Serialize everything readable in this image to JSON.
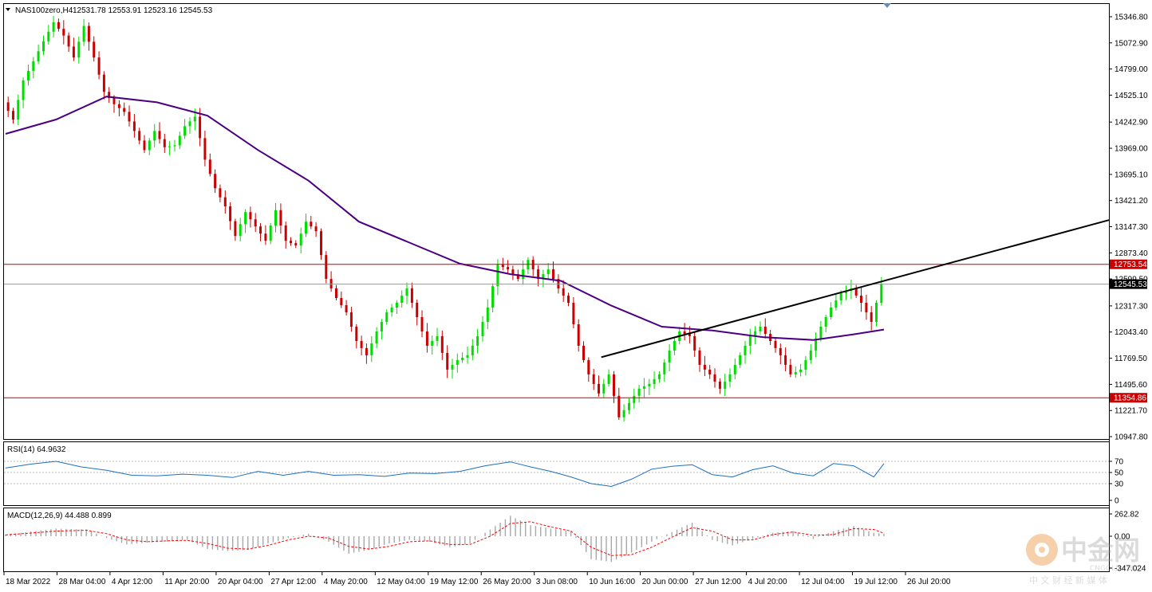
{
  "header": {
    "symbol": "NAS100zero,H4",
    "ohlc": "12531.78 12553.91 12523.16 12545.53"
  },
  "rsi_label": "RSI(14) 64.9632",
  "macd_label": "MACD(12,26,9) 44.488 0.899",
  "watermark": {
    "brand": "中金网",
    "domain": "CNGOLD.ORG",
    "slogan": "中 文 财 经 新 媒 体"
  },
  "colors": {
    "bull": "#00dd00",
    "bear": "#cc0000",
    "ma": "#4b0082",
    "hline": "#cc0000",
    "trend": "#000000",
    "rsi": "#1e6fbf",
    "macd_signal": "#ff0000",
    "macd_hist": "#a8a8a8"
  },
  "chart_data": {
    "type": "candlestick",
    "symbol": "NAS100zero",
    "timeframe": "H4",
    "last": {
      "open": 12531.78,
      "high": 12553.91,
      "low": 12523.16,
      "close": 12545.53
    },
    "price_axis_ticks": [
      "15346.80",
      "15072.90",
      "14799.00",
      "14525.10",
      "14242.90",
      "13969.00",
      "13695.10",
      "13421.20",
      "13147.30",
      "12873.40",
      "12599.50",
      "12317.30",
      "12043.40",
      "11769.50",
      "11495.60",
      "11221.70",
      "10947.80"
    ],
    "time_axis_labels": [
      "18 Mar 2022",
      "28 Mar 04:00",
      "4 Apr 12:00",
      "11 Apr 20:00",
      "20 Apr 04:00",
      "27 Apr 12:00",
      "4 May 20:00",
      "12 May 04:00",
      "19 May 12:00",
      "26 May 20:00",
      "3 Jun 08:00",
      "10 Jun 16:00",
      "20 Jun 00:00",
      "27 Jun 12:00",
      "4 Jul 20:00",
      "12 Jul 04:00",
      "19 Jul 12:00",
      "26 Jul 20:00"
    ],
    "price_path": [
      [
        0,
        14450
      ],
      [
        2,
        14270
      ],
      [
        4,
        14680
      ],
      [
        6,
        14880
      ],
      [
        8,
        15090
      ],
      [
        10,
        15290
      ],
      [
        12,
        15150
      ],
      [
        14,
        14920
      ],
      [
        16,
        15250
      ],
      [
        18,
        14920
      ],
      [
        20,
        14560
      ],
      [
        22,
        14430
      ],
      [
        24,
        14350
      ],
      [
        26,
        14150
      ],
      [
        28,
        13950
      ],
      [
        30,
        14150
      ],
      [
        32,
        13980
      ],
      [
        34,
        14000
      ],
      [
        36,
        14200
      ],
      [
        38,
        14300
      ],
      [
        40,
        13850
      ],
      [
        42,
        13550
      ],
      [
        44,
        13360
      ],
      [
        46,
        13050
      ],
      [
        48,
        13300
      ],
      [
        50,
        13150
      ],
      [
        52,
        13000
      ],
      [
        54,
        13320
      ],
      [
        56,
        13000
      ],
      [
        58,
        12950
      ],
      [
        60,
        13200
      ],
      [
        62,
        13100
      ],
      [
        64,
        12600
      ],
      [
        66,
        12400
      ],
      [
        68,
        12250
      ],
      [
        70,
        11950
      ],
      [
        72,
        11800
      ],
      [
        74,
        12050
      ],
      [
        76,
        12250
      ],
      [
        78,
        12350
      ],
      [
        80,
        12500
      ],
      [
        82,
        12200
      ],
      [
        84,
        11900
      ],
      [
        86,
        12000
      ],
      [
        88,
        11650
      ],
      [
        90,
        11750
      ],
      [
        92,
        11800
      ],
      [
        94,
        12000
      ],
      [
        96,
        12300
      ],
      [
        98,
        12750
      ],
      [
        100,
        12700
      ],
      [
        102,
        12600
      ],
      [
        104,
        12800
      ],
      [
        106,
        12600
      ],
      [
        108,
        12700
      ],
      [
        110,
        12500
      ],
      [
        112,
        12350
      ],
      [
        114,
        11900
      ],
      [
        116,
        11600
      ],
      [
        118,
        11400
      ],
      [
        120,
        11600
      ],
      [
        122,
        11150
      ],
      [
        124,
        11300
      ],
      [
        126,
        11450
      ],
      [
        128,
        11500
      ],
      [
        130,
        11600
      ],
      [
        132,
        11850
      ],
      [
        134,
        12050
      ],
      [
        136,
        12000
      ],
      [
        138,
        11700
      ],
      [
        140,
        11600
      ],
      [
        142,
        11450
      ],
      [
        144,
        11600
      ],
      [
        146,
        11800
      ],
      [
        148,
        12000
      ],
      [
        150,
        12100
      ],
      [
        152,
        11950
      ],
      [
        154,
        11800
      ],
      [
        156,
        11600
      ],
      [
        158,
        11650
      ],
      [
        160,
        11850
      ],
      [
        162,
        12100
      ],
      [
        164,
        12300
      ],
      [
        166,
        12450
      ],
      [
        168,
        12500
      ],
      [
        170,
        12350
      ],
      [
        172,
        12150
      ],
      [
        174,
        12550
      ]
    ],
    "ma_path": [
      [
        0,
        14120
      ],
      [
        10,
        14270
      ],
      [
        20,
        14510
      ],
      [
        30,
        14450
      ],
      [
        40,
        14310
      ],
      [
        50,
        13950
      ],
      [
        60,
        13630
      ],
      [
        70,
        13200
      ],
      [
        80,
        12980
      ],
      [
        90,
        12760
      ],
      [
        100,
        12650
      ],
      [
        110,
        12580
      ],
      [
        120,
        12320
      ],
      [
        130,
        12100
      ],
      [
        140,
        12060
      ],
      [
        150,
        11990
      ],
      [
        160,
        11960
      ],
      [
        168,
        12020
      ],
      [
        174,
        12070
      ]
    ],
    "horizontal_levels": [
      12753.54,
      11354.86
    ],
    "current_price_label": "12545.53",
    "trendline": {
      "from_index": 118,
      "from_price": 11780,
      "to_index": 174,
      "to_price": 12580
    },
    "rsi": {
      "ticks": [
        "70",
        "50",
        "30",
        "0"
      ],
      "levels": [
        70,
        50,
        30
      ],
      "path": [
        [
          0,
          58
        ],
        [
          5,
          65
        ],
        [
          10,
          70
        ],
        [
          15,
          60
        ],
        [
          20,
          54
        ],
        [
          25,
          45
        ],
        [
          30,
          44
        ],
        [
          35,
          47
        ],
        [
          40,
          45
        ],
        [
          45,
          41
        ],
        [
          50,
          52
        ],
        [
          55,
          45
        ],
        [
          60,
          52
        ],
        [
          65,
          45
        ],
        [
          70,
          46
        ],
        [
          75,
          43
        ],
        [
          80,
          49
        ],
        [
          85,
          48
        ],
        [
          90,
          52
        ],
        [
          95,
          62
        ],
        [
          100,
          69
        ],
        [
          104,
          60
        ],
        [
          108,
          52
        ],
        [
          112,
          42
        ],
        [
          116,
          30
        ],
        [
          120,
          25
        ],
        [
          124,
          38
        ],
        [
          128,
          56
        ],
        [
          132,
          61
        ],
        [
          136,
          64
        ],
        [
          138,
          55
        ],
        [
          140,
          46
        ],
        [
          144,
          42
        ],
        [
          148,
          55
        ],
        [
          152,
          62
        ],
        [
          156,
          49
        ],
        [
          160,
          44
        ],
        [
          164,
          66
        ],
        [
          168,
          62
        ],
        [
          172,
          42
        ],
        [
          174,
          66
        ]
      ]
    },
    "macd": {
      "ticks": [
        "262.82",
        "0.00",
        "-347.024"
      ],
      "hist_path": [
        [
          0,
          20
        ],
        [
          10,
          90
        ],
        [
          16,
          80
        ],
        [
          20,
          -20
        ],
        [
          24,
          -90
        ],
        [
          28,
          -70
        ],
        [
          32,
          -60
        ],
        [
          36,
          -40
        ],
        [
          40,
          -140
        ],
        [
          44,
          -160
        ],
        [
          48,
          -150
        ],
        [
          52,
          -80
        ],
        [
          56,
          -20
        ],
        [
          60,
          30
        ],
        [
          64,
          -60
        ],
        [
          68,
          -190
        ],
        [
          72,
          -150
        ],
        [
          76,
          -80
        ],
        [
          80,
          -40
        ],
        [
          84,
          -60
        ],
        [
          88,
          -120
        ],
        [
          92,
          -80
        ],
        [
          96,
          80
        ],
        [
          100,
          240
        ],
        [
          104,
          130
        ],
        [
          108,
          90
        ],
        [
          112,
          60
        ],
        [
          116,
          -250
        ],
        [
          120,
          -280
        ],
        [
          124,
          -180
        ],
        [
          128,
          -60
        ],
        [
          132,
          50
        ],
        [
          136,
          160
        ],
        [
          140,
          -40
        ],
        [
          144,
          -100
        ],
        [
          148,
          -30
        ],
        [
          152,
          40
        ],
        [
          156,
          60
        ],
        [
          160,
          -30
        ],
        [
          164,
          60
        ],
        [
          168,
          120
        ],
        [
          172,
          40
        ],
        [
          174,
          30
        ]
      ],
      "signal_path": [
        [
          0,
          15
        ],
        [
          10,
          60
        ],
        [
          16,
          70
        ],
        [
          20,
          30
        ],
        [
          24,
          -40
        ],
        [
          28,
          -60
        ],
        [
          32,
          -50
        ],
        [
          36,
          -45
        ],
        [
          40,
          -80
        ],
        [
          44,
          -130
        ],
        [
          48,
          -140
        ],
        [
          52,
          -100
        ],
        [
          56,
          -40
        ],
        [
          60,
          0
        ],
        [
          64,
          -20
        ],
        [
          68,
          -110
        ],
        [
          72,
          -140
        ],
        [
          76,
          -110
        ],
        [
          80,
          -60
        ],
        [
          84,
          -50
        ],
        [
          88,
          -90
        ],
        [
          92,
          -90
        ],
        [
          96,
          0
        ],
        [
          100,
          150
        ],
        [
          104,
          170
        ],
        [
          108,
          110
        ],
        [
          112,
          60
        ],
        [
          116,
          -120
        ],
        [
          120,
          -210
        ],
        [
          124,
          -200
        ],
        [
          128,
          -120
        ],
        [
          132,
          -10
        ],
        [
          136,
          100
        ],
        [
          140,
          60
        ],
        [
          144,
          -40
        ],
        [
          148,
          -40
        ],
        [
          152,
          20
        ],
        [
          156,
          50
        ],
        [
          160,
          10
        ],
        [
          164,
          20
        ],
        [
          168,
          90
        ],
        [
          172,
          80
        ],
        [
          174,
          35
        ]
      ]
    }
  }
}
